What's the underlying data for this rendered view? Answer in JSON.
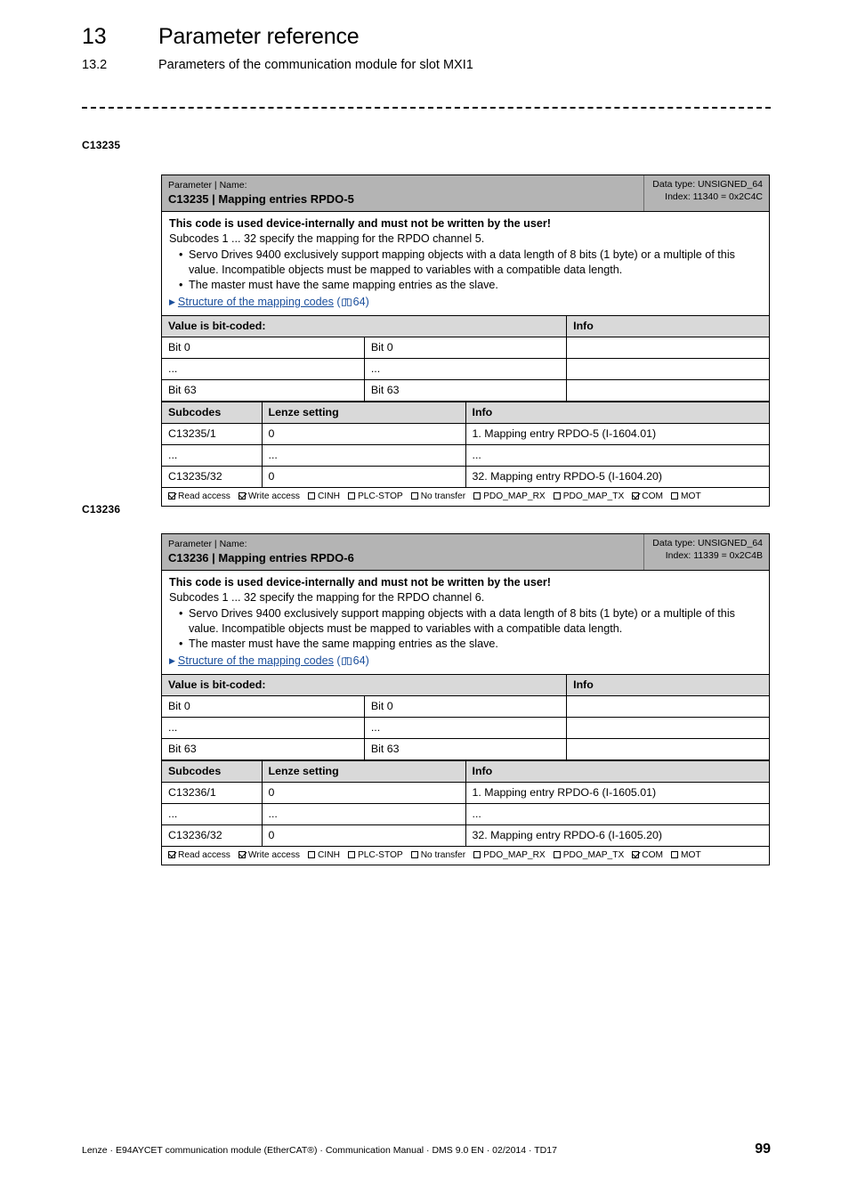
{
  "header": {
    "chapter_number": "13",
    "chapter_title": "Parameter reference",
    "section_number": "13.2",
    "section_title": "Parameters of the communication module for slot MXI1"
  },
  "footer": {
    "text": "Lenze · E94AYCET communication module (EtherCAT®) · Communication Manual · DMS 9.0 EN · 02/2014 · TD17",
    "page_number": "99"
  },
  "access_legend": {
    "read": "Read access",
    "write": "Write access",
    "cinh": "CINH",
    "plc_stop": "PLC-STOP",
    "no_transfer": "No transfer",
    "pdo_map_rx": "PDO_MAP_RX",
    "pdo_map_tx": "PDO_MAP_TX",
    "com": "COM",
    "mot": "MOT"
  },
  "parameters": [
    {
      "margin_label": "C13235",
      "kicker": "Parameter | Name:",
      "name": "C13235 | Mapping entries RPDO-5",
      "data_type": "Data type: UNSIGNED_64",
      "index": "Index: 11340 = 0x2C4C",
      "warning": "This code is used device-internally and must not be written by the user!",
      "subcode_line": "Subcodes 1 ... 32 specify the mapping for the RPDO channel 5.",
      "bullets": [
        "Servo Drives 9400 exclusively support mapping objects with a data length of 8 bits (1 byte) or a multiple of this value. Incompatible objects must be mapped to variables with a compatible data length.",
        "The master must have the same mapping entries as the slave."
      ],
      "xref_link": "Structure of the mapping codes",
      "xref_page": "64",
      "bitcoded": {
        "header_label": "Value is bit-coded:",
        "header_info": "Info",
        "rows": [
          {
            "bit": "Bit 0",
            "name": "Bit 0",
            "info": ""
          },
          {
            "bit": "...",
            "name": "...",
            "info": ""
          },
          {
            "bit": "Bit 63",
            "name": "Bit 63",
            "info": ""
          }
        ]
      },
      "subcodes": {
        "headers": [
          "Subcodes",
          "Lenze setting",
          "Info"
        ],
        "rows": [
          [
            "C13235/1",
            "0",
            "1. Mapping entry RPDO-5 (I-1604.01)"
          ],
          [
            "...",
            "...",
            "..."
          ],
          [
            "C13235/32",
            "0",
            "32. Mapping entry RPDO-5 (I-1604.20)"
          ]
        ]
      },
      "access": {
        "read": true,
        "write": true,
        "cinh": false,
        "plc_stop": false,
        "no_transfer": false,
        "pdo_map_rx": false,
        "pdo_map_tx": false,
        "com": true,
        "mot": false
      }
    },
    {
      "margin_label": "C13236",
      "kicker": "Parameter | Name:",
      "name": "C13236 | Mapping entries RPDO-6",
      "data_type": "Data type: UNSIGNED_64",
      "index": "Index: 11339 = 0x2C4B",
      "warning": "This code is used device-internally and must not be written by the user!",
      "subcode_line": "Subcodes 1 ... 32 specify the mapping for the RPDO channel 6.",
      "bullets": [
        "Servo Drives 9400 exclusively support mapping objects with a data length of 8 bits (1 byte) or a multiple of this value. Incompatible objects must be mapped to variables with a compatible data length.",
        "The master must have the same mapping entries as the slave."
      ],
      "xref_link": "Structure of the mapping codes",
      "xref_page": "64",
      "bitcoded": {
        "header_label": "Value is bit-coded:",
        "header_info": "Info",
        "rows": [
          {
            "bit": "Bit 0",
            "name": "Bit 0",
            "info": ""
          },
          {
            "bit": "...",
            "name": "...",
            "info": ""
          },
          {
            "bit": "Bit 63",
            "name": "Bit 63",
            "info": ""
          }
        ]
      },
      "subcodes": {
        "headers": [
          "Subcodes",
          "Lenze setting",
          "Info"
        ],
        "rows": [
          [
            "C13236/1",
            "0",
            "1. Mapping entry RPDO-6 (I-1605.01)"
          ],
          [
            "...",
            "...",
            "..."
          ],
          [
            "C13236/32",
            "0",
            "32. Mapping entry RPDO-6 (I-1605.20)"
          ]
        ]
      },
      "access": {
        "read": true,
        "write": true,
        "cinh": false,
        "plc_stop": false,
        "no_transfer": false,
        "pdo_map_rx": false,
        "pdo_map_tx": false,
        "com": true,
        "mot": false
      }
    }
  ]
}
